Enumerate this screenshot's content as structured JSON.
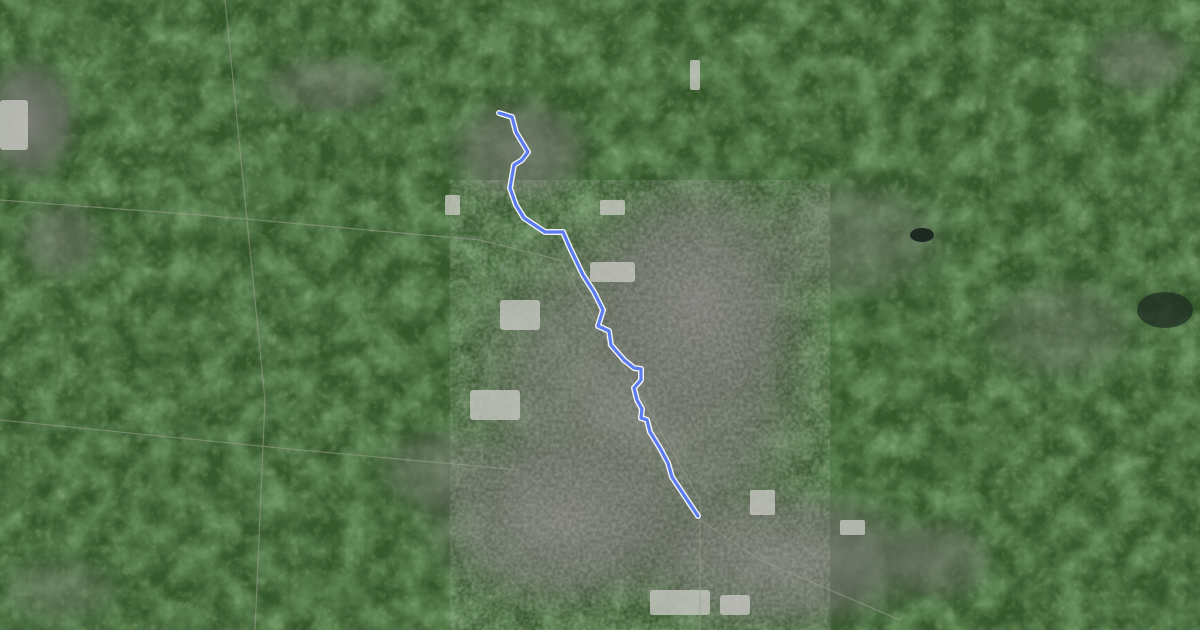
{
  "map": {
    "type": "satellite",
    "basemap_colors": {
      "farmland_dark": "#2e5127",
      "farmland_mid": "#3f6a32",
      "farmland_light": "#5a8a45",
      "urban": "#8a8c86",
      "urban_dark": "#5c5f5a",
      "industrial": "#c9cac4",
      "water": "#1c2a22"
    },
    "route": {
      "color": "#5b7cf0",
      "outline_color": "#ffffff",
      "icon": "route-line"
    }
  }
}
